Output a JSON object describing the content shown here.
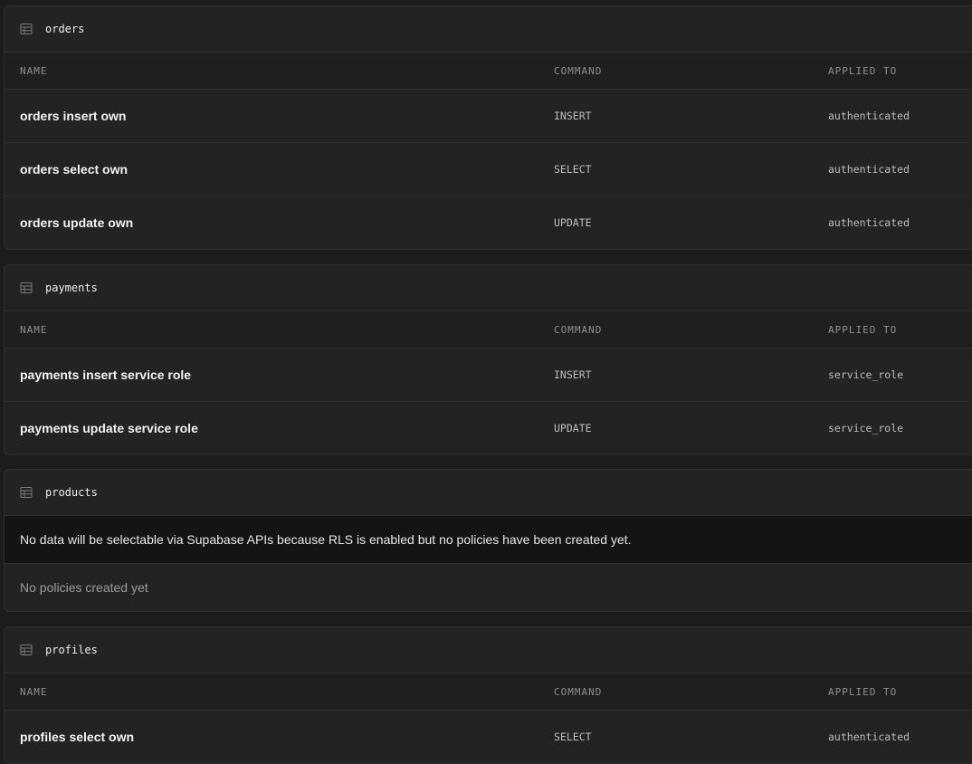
{
  "columns": {
    "name": "NAME",
    "command": "COMMAND",
    "applied_to": "APPLIED TO"
  },
  "tables": [
    {
      "name": "orders",
      "policies": [
        {
          "name": "orders insert own",
          "command": "INSERT",
          "applied_to": "authenticated"
        },
        {
          "name": "orders select own",
          "command": "SELECT",
          "applied_to": "authenticated"
        },
        {
          "name": "orders update own",
          "command": "UPDATE",
          "applied_to": "authenticated"
        }
      ]
    },
    {
      "name": "payments",
      "policies": [
        {
          "name": "payments insert service role",
          "command": "INSERT",
          "applied_to": "service_role"
        },
        {
          "name": "payments update service role",
          "command": "UPDATE",
          "applied_to": "service_role"
        }
      ]
    },
    {
      "name": "products",
      "notice": "No data will be selectable via Supabase APIs because RLS is enabled but no policies have been created yet.",
      "empty_text": "No policies created yet"
    },
    {
      "name": "profiles",
      "policies": [
        {
          "name": "profiles select own",
          "command": "SELECT",
          "applied_to": "authenticated"
        }
      ]
    }
  ],
  "icons": {
    "table": "table-icon"
  },
  "colors": {
    "background": "#1c1c1c",
    "card": "#232323",
    "notice_bg": "#141414",
    "border": "#2e2e2e"
  }
}
